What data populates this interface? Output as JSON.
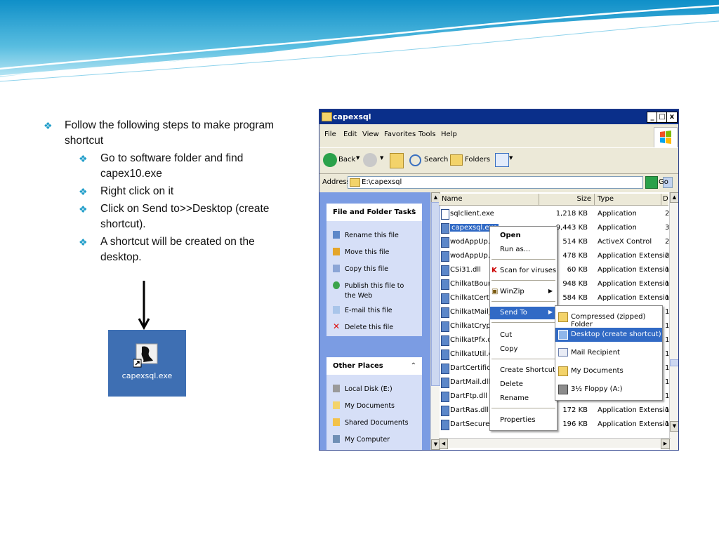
{
  "slide": {
    "bullets": [
      {
        "level": 1,
        "text": "Follow the following steps to make program shortcut"
      },
      {
        "level": 2,
        "text": "Go to software folder and find capex10.exe"
      },
      {
        "level": 2,
        "text": "Right click on it"
      },
      {
        "level": 2,
        "text": "Click on Send to>>Desktop (create shortcut)."
      },
      {
        "level": 2,
        "text": "A shortcut will be created on the desktop."
      }
    ],
    "bullet_marker": "❖",
    "shortcut_label": "capexsql.exe",
    "accent_color": "#1f9dc9",
    "desktop_color": "#3e6fb3"
  },
  "window": {
    "title": "capexsql",
    "title_buttons": [
      "_",
      "□",
      "x"
    ],
    "menu": [
      "File",
      "Edit",
      "View",
      "Favorites",
      "Tools",
      "Help"
    ],
    "toolbar": {
      "back": "Back",
      "search": "Search",
      "folders": "Folders"
    },
    "address": {
      "label": "Address",
      "value": "E:\\capexsql",
      "go": "Go"
    }
  },
  "left_pane": {
    "file_tasks": {
      "title": "File and Folder Tasks",
      "items": [
        "Rename this file",
        "Move this file",
        "Copy this file",
        "Publish this file to the Web",
        "E-mail this file",
        "Delete this file"
      ]
    },
    "other_places": {
      "title": "Other Places",
      "items": [
        "Local Disk (E:)",
        "My Documents",
        "Shared Documents",
        "My Computer"
      ]
    }
  },
  "file_list": {
    "columns": [
      "Name",
      "Size",
      "Type",
      "D"
    ],
    "rows": [
      {
        "name": "sqlclient.exe",
        "size": "1,218 KB",
        "type": "Application",
        "extra": "2"
      },
      {
        "name": "capexsql.exe",
        "size": "9,443 KB",
        "type": "Application",
        "extra": "3"
      },
      {
        "name": "wodAppUp.oc",
        "size": "514 KB",
        "type": "ActiveX Control",
        "extra": "2"
      },
      {
        "name": "wodAppUp.dll",
        "size": "478 KB",
        "type": "Application Extension",
        "extra": "2"
      },
      {
        "name": "CSi31.dll",
        "size": "60 KB",
        "type": "Application Extension",
        "extra": "1"
      },
      {
        "name": "ChilkatBounce",
        "size": "948 KB",
        "type": "Application Extension",
        "extra": "1"
      },
      {
        "name": "ChilkatCert.dll",
        "size": "584 KB",
        "type": "Application Extension",
        "extra": "1"
      },
      {
        "name": "ChilkatMail_v7",
        "size": "",
        "type": "",
        "extra": "1"
      },
      {
        "name": "ChilkatCrypt2.",
        "size": "",
        "type": "",
        "extra": "1"
      },
      {
        "name": "ChilkatPfx.dll",
        "size": "",
        "type": "",
        "extra": "1"
      },
      {
        "name": "ChilkatUtil.dll",
        "size": "",
        "type": "",
        "extra": "1"
      },
      {
        "name": "DartCertificate",
        "size": "",
        "type": "",
        "extra": "1"
      },
      {
        "name": "DartMail.dll",
        "size": "",
        "type": "",
        "extra": "1"
      },
      {
        "name": "DartFtp.dll",
        "size": "",
        "type": "",
        "extra": "1"
      },
      {
        "name": "DartRas.dll",
        "size": "172 KB",
        "type": "Application Extension",
        "extra": "1"
      },
      {
        "name": "DartSecure2.c",
        "size": "196 KB",
        "type": "Application Extension",
        "extra": "1"
      }
    ]
  },
  "context_menu": {
    "items": [
      "Open",
      "Run as...",
      "Scan for viruses",
      "WinZip",
      "Send To",
      "Cut",
      "Copy",
      "Create Shortcut",
      "Delete",
      "Rename",
      "Properties"
    ]
  },
  "sendto_menu": {
    "items": [
      "Compressed (zipped) Folder",
      "Desktop (create shortcut)",
      "Mail Recipient",
      "My Documents",
      "3½ Floppy (A:)"
    ]
  }
}
